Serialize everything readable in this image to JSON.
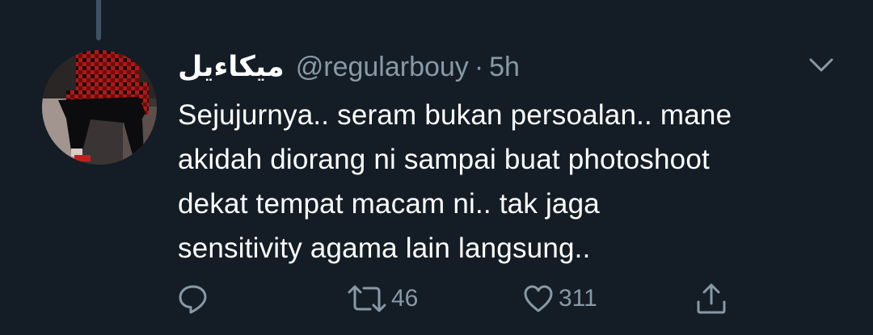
{
  "tweet": {
    "display_name": "ميكاءيل",
    "handle": "@regularbouy",
    "separator": "·",
    "time": "5h",
    "text_lines": [
      "Sejujurnya.. seram bukan persoalan.. mane",
      "akidah diorang ni sampai buat photoshoot",
      "dekat tempat macam ni.. tak jaga",
      "sensitivity agama lain langsung.."
    ],
    "retweet_count": "46",
    "like_count": "311"
  },
  "icons": {
    "reply": "reply-icon",
    "retweet": "retweet-icon",
    "like": "heart-icon",
    "share": "share-icon",
    "more": "chevron-down-icon"
  },
  "colors": {
    "background": "#141d26",
    "text": "#ffffff",
    "secondary": "#8899a6",
    "thread_line": "#3d5466"
  }
}
